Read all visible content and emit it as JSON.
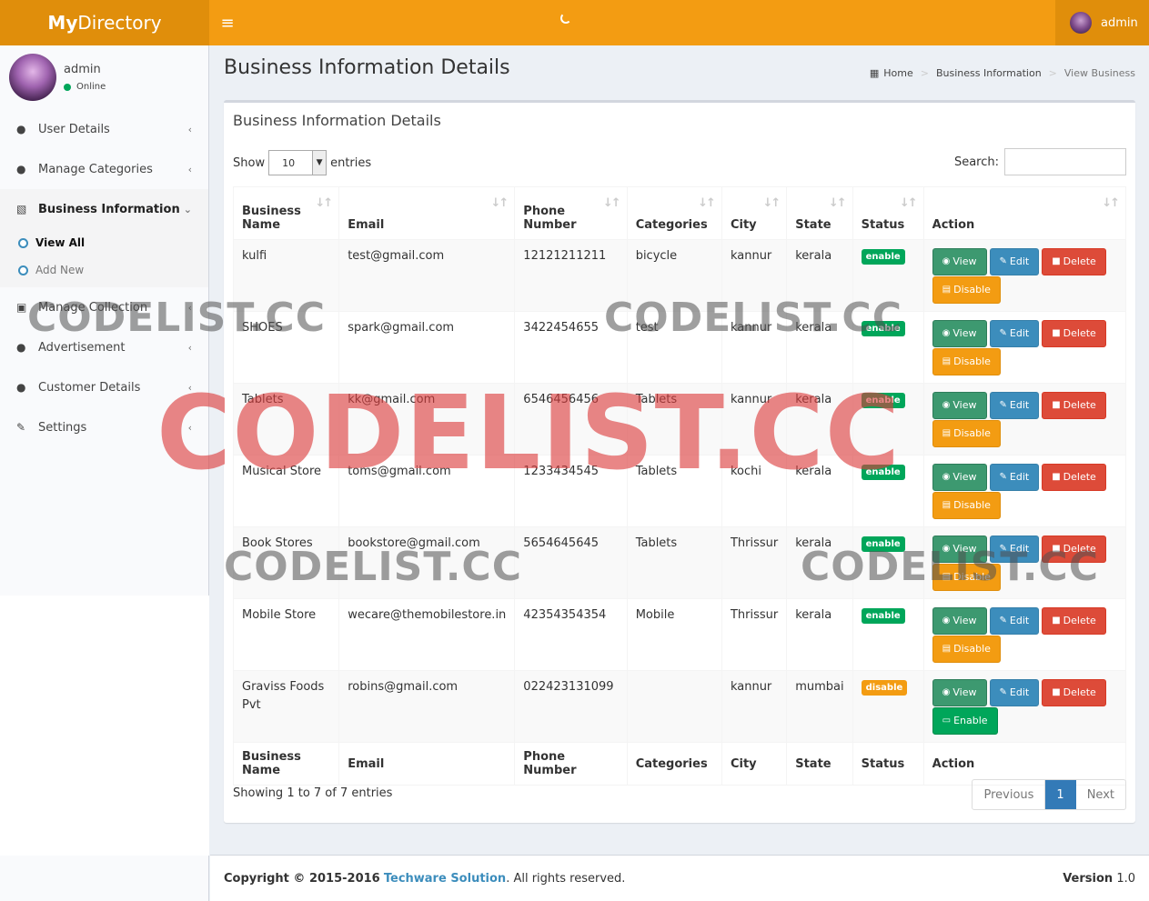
{
  "header": {
    "logo_bold": "My",
    "logo_rest": "Directory",
    "menu_icon": "hamburger-icon",
    "user_name": "admin"
  },
  "sidebar": {
    "user": {
      "name": "admin",
      "status": "Online"
    },
    "items": [
      {
        "label": "User Details",
        "icon": "user-icon"
      },
      {
        "label": "Manage Categories",
        "icon": "user-icon"
      },
      {
        "label": "Business Information",
        "icon": "building-icon"
      },
      {
        "label": "Manage Collection",
        "icon": "cube-icon"
      },
      {
        "label": "Advertisement",
        "icon": "user-icon"
      },
      {
        "label": "Customer Details",
        "icon": "users-icon"
      },
      {
        "label": "Settings",
        "icon": "wrench-icon"
      }
    ],
    "submenu": [
      "View All",
      "Add New"
    ]
  },
  "page": {
    "title": "Business Information Details",
    "breadcrumb": [
      "Home",
      "Business Information",
      "View Business"
    ]
  },
  "box": {
    "title": "Business Information Details",
    "show_label": "Show",
    "entries_value": "10",
    "entries_label": "entries",
    "search_label": "Search:",
    "search_value": ""
  },
  "table": {
    "headers": [
      "Business Name",
      "Email",
      "Phone Number",
      "Categories",
      "City",
      "State",
      "Status",
      "Action"
    ],
    "header_lines": [
      [
        "Business",
        "Name"
      ],
      [
        "Email"
      ],
      [
        "Phone",
        "Number"
      ],
      [
        "Categories"
      ],
      [
        "City"
      ],
      [
        "State"
      ],
      [
        "Status"
      ],
      [
        "Action"
      ]
    ],
    "rows": [
      {
        "name": "kulfi",
        "email": "test@gmail.com",
        "phone": "12121211211",
        "category": "bicycle",
        "city": "kannur",
        "state": "kerala",
        "status": "enable",
        "toggle": "Disable"
      },
      {
        "name": "SHOES",
        "email": "spark@gmail.com",
        "phone": "3422454655",
        "category": "test",
        "city": "kannur",
        "state": "kerala",
        "status": "enable",
        "toggle": "Disable"
      },
      {
        "name": "Tablets",
        "email": "kk@gmail.com",
        "phone": "6546456456",
        "category": "Tablets",
        "city": "kannur",
        "state": "kerala",
        "status": "enable",
        "toggle": "Disable"
      },
      {
        "name": "Musical Store",
        "email": "toms@gmail.com",
        "phone": "1233434545",
        "category": "Tablets",
        "city": "kochi",
        "state": "kerala",
        "status": "enable",
        "toggle": "Disable"
      },
      {
        "name": "Book Stores",
        "email": "bookstore@gmail.com",
        "phone": "5654645645",
        "category": "Tablets",
        "city": "Thrissur",
        "state": "kerala",
        "status": "enable",
        "toggle": "Disable"
      },
      {
        "name": "Mobile Store",
        "email": "wecare@themobilestore.in",
        "phone": "42354354354",
        "category": "Mobile",
        "city": "Thrissur",
        "state": "kerala",
        "status": "enable",
        "toggle": "Disable"
      },
      {
        "name": "Graviss Foods Pvt",
        "email": "robins@gmail.com",
        "phone": "022423131099",
        "category": "",
        "city": "kannur",
        "state": "mumbai",
        "status": "disable",
        "toggle": "Enable"
      }
    ],
    "actions": {
      "view": "View",
      "edit": "Edit",
      "delete": "Delete"
    }
  },
  "pagination": {
    "info": "Showing 1 to 7 of 7 entries",
    "previous": "Previous",
    "current": "1",
    "next": "Next"
  },
  "footer": {
    "copyright": "Copyright © 2015-2016",
    "company": "Techware Solution",
    "rights": ". All rights reserved.",
    "version_label": "Version",
    "version_value": "1.0"
  },
  "watermark": "CODELIST.CC",
  "colors": {
    "header": "#f39c12",
    "enable": "#00a65a",
    "disable": "#f39c12",
    "delete": "#dd4b39",
    "edit": "#3c8dbc",
    "view": "#3d9970"
  }
}
